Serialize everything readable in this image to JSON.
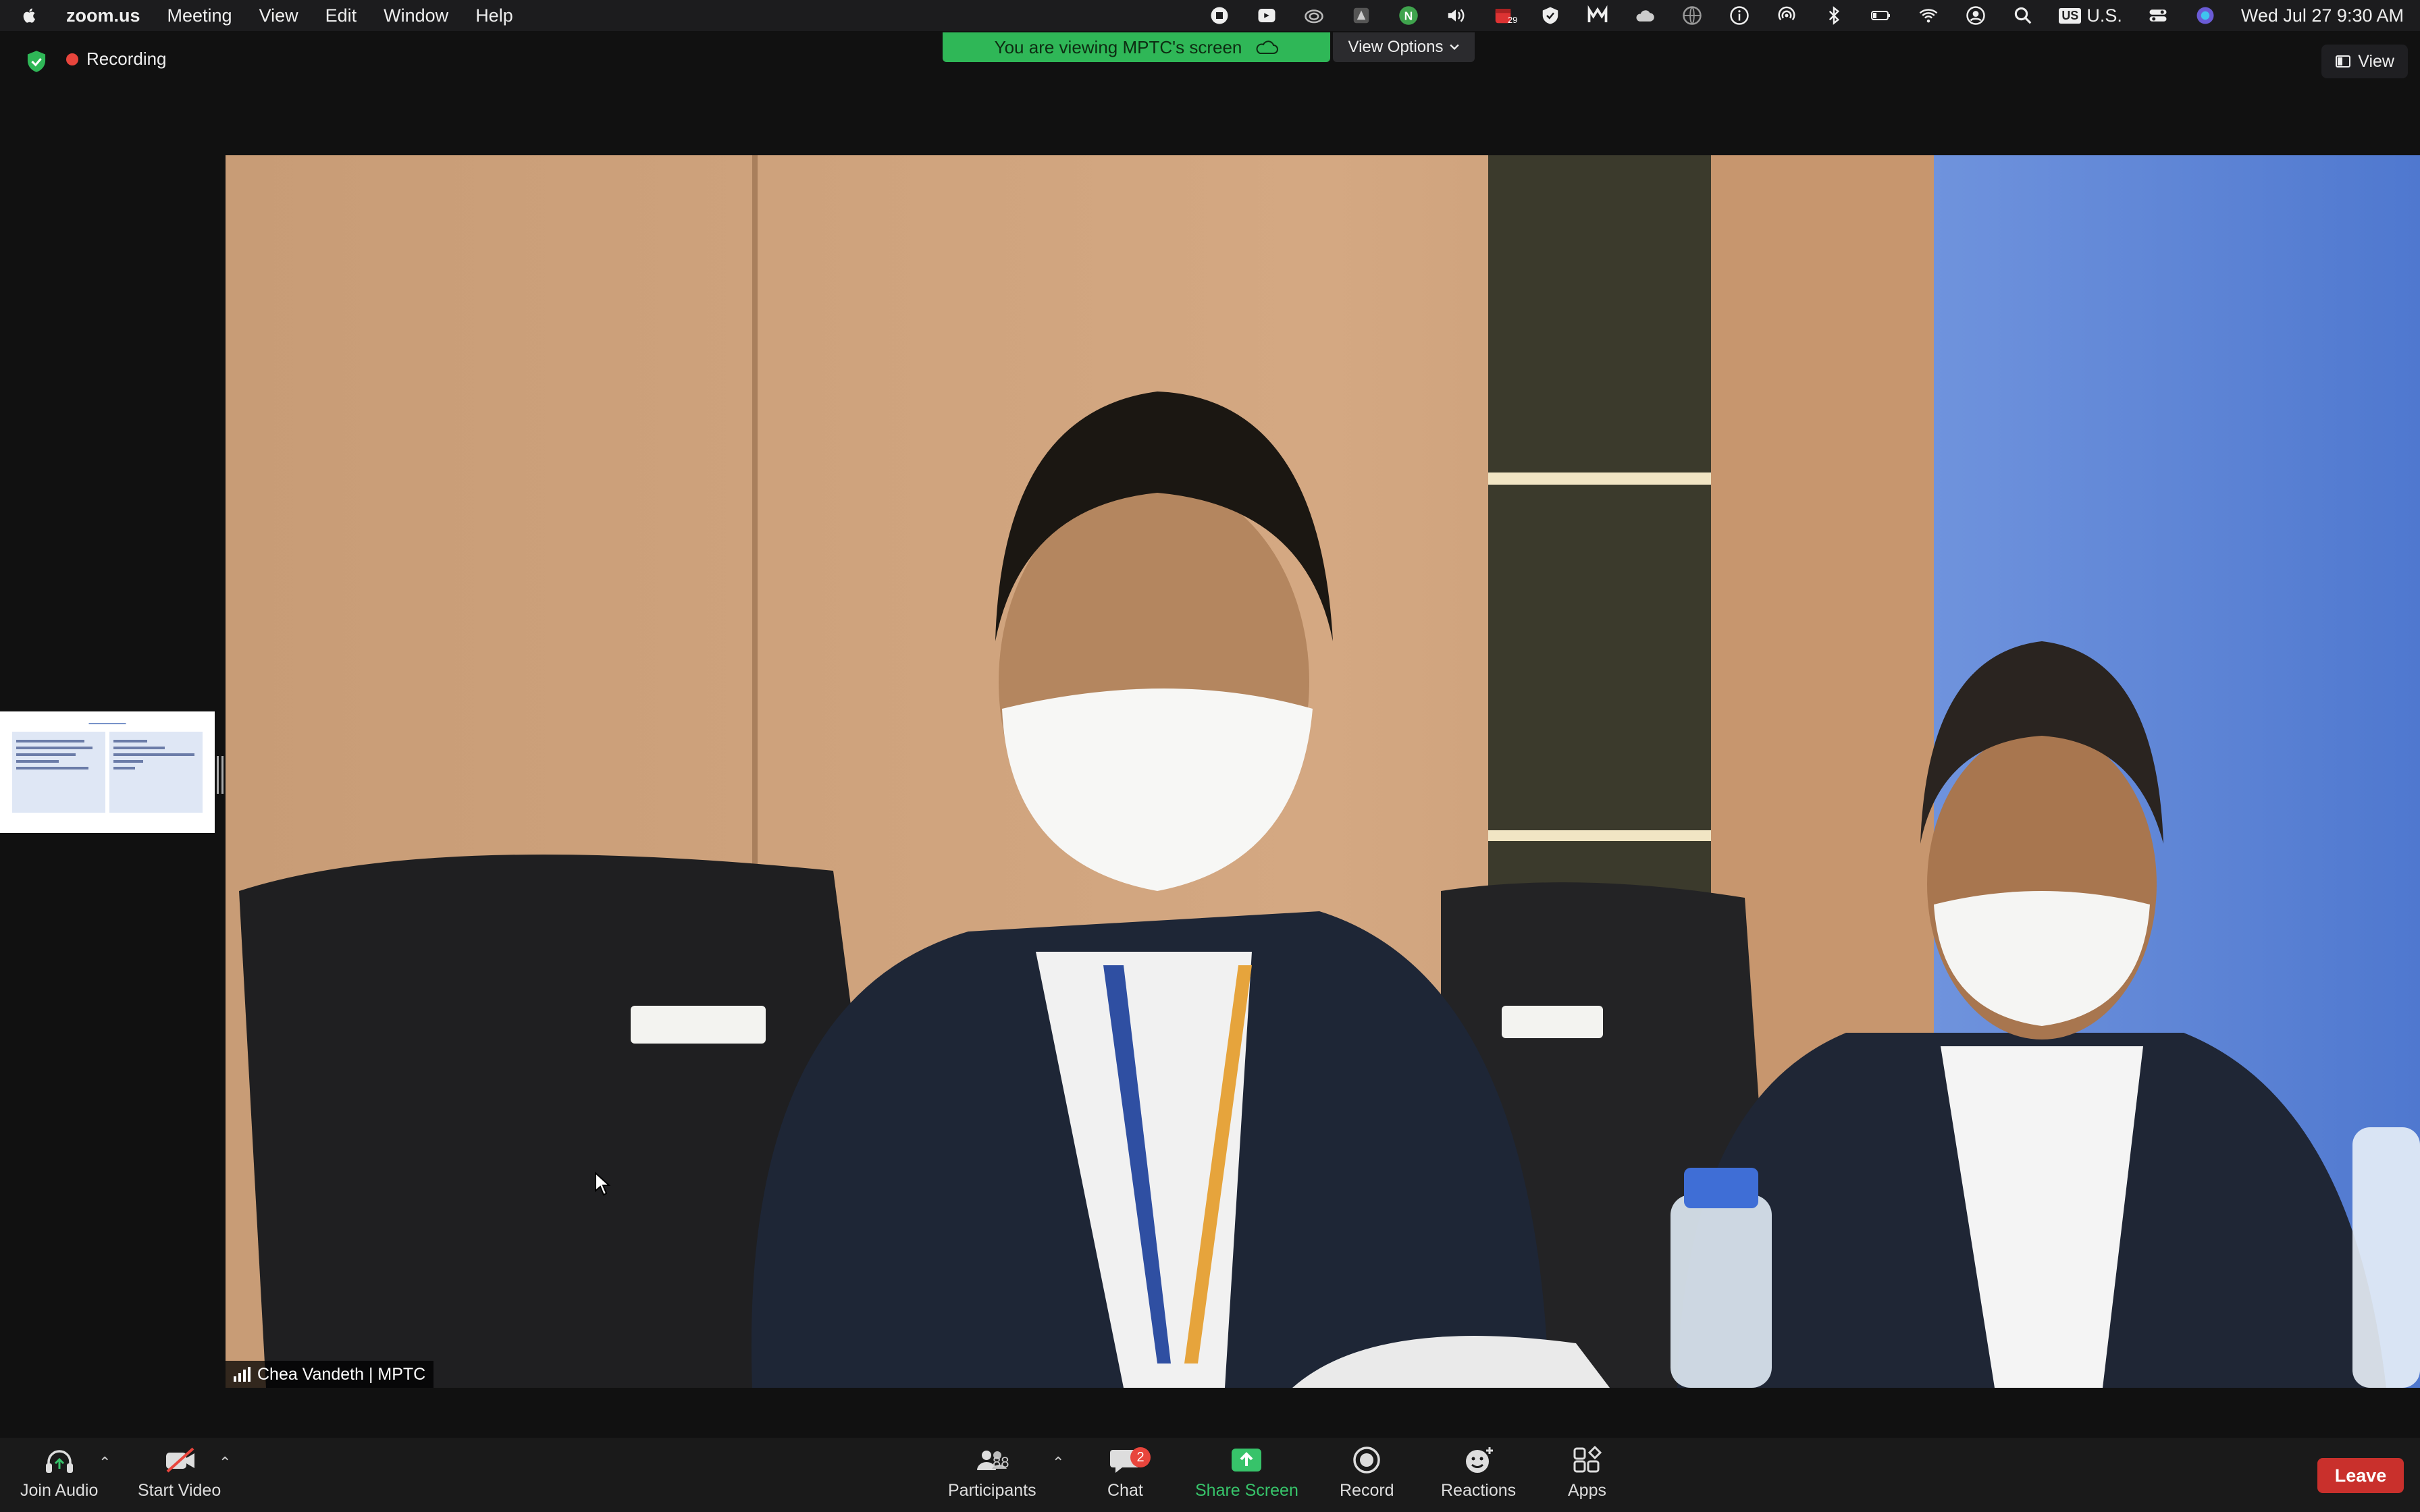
{
  "menubar": {
    "app_name": "zoom.us",
    "items": [
      "Meeting",
      "View",
      "Edit",
      "Window",
      "Help"
    ],
    "tray_icons": [
      "stop-record-icon",
      "camera-icon",
      "creative-cloud-icon",
      "app-icon",
      "n-icon",
      "volume-icon",
      "calendar-icon",
      "shield-icon",
      "m-icon",
      "cloud-icon",
      "globe-icon",
      "info-icon",
      "airdrop-icon",
      "bluetooth-icon",
      "battery-icon",
      "wifi-icon",
      "user-icon",
      "search-icon"
    ],
    "calendar_badge": "29",
    "language_flag": "US",
    "language": "U.S.",
    "clock": "Wed Jul 27  9:30 AM"
  },
  "header": {
    "recording_label": "Recording",
    "share_banner": "You are viewing MPTC's screen",
    "view_options": "View Options",
    "view_button": "View"
  },
  "video": {
    "speaker_name": "Chea Vandeth | MPTC"
  },
  "toolbar": {
    "join_audio": "Join Audio",
    "start_video": "Start Video",
    "participants": "Participants",
    "participants_count": "88",
    "chat": "Chat",
    "chat_badge": "2",
    "share_screen": "Share Screen",
    "record": "Record",
    "reactions": "Reactions",
    "apps": "Apps",
    "leave": "Leave"
  },
  "colors": {
    "share_banner_bg": "#2fb757",
    "leave_bg": "#c9302c",
    "recording_dot": "#e8453c",
    "share_screen_accent": "#37c36a"
  }
}
